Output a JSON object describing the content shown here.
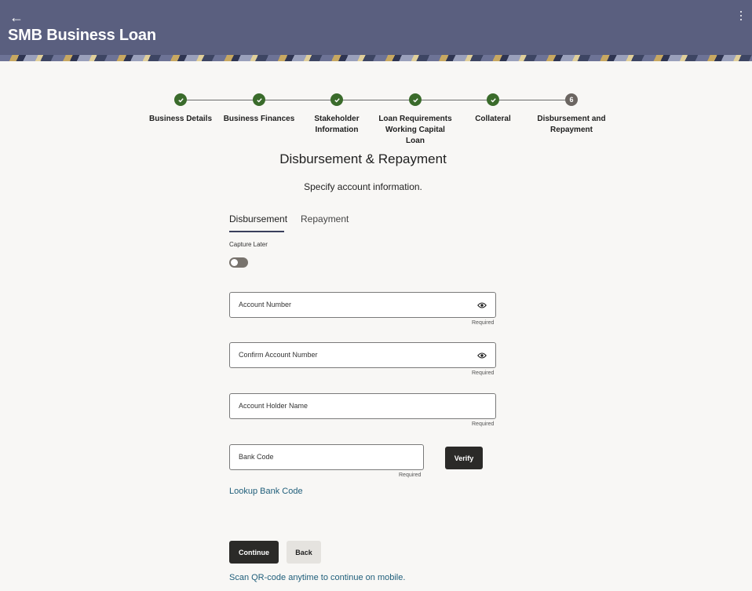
{
  "header": {
    "back_icon": "back-arrow-icon",
    "title": "SMB Business Loan",
    "menu_icon": "more-vertical-icon",
    "background_color": "#5a5f7f"
  },
  "stepper": {
    "steps": [
      {
        "label": "Business Details",
        "status": "done"
      },
      {
        "label": "Business Finances",
        "status": "done"
      },
      {
        "label": "Stakeholder Information",
        "status": "done"
      },
      {
        "label": "Loan Requirements Working Capital Loan",
        "status": "done"
      },
      {
        "label": "Collateral",
        "status": "done"
      },
      {
        "label": "Disbursement and Repayment",
        "status": "current",
        "number": "6"
      }
    ],
    "done_color": "#3a6b2b"
  },
  "main": {
    "title": "Disbursement & Repayment",
    "subtitle": "Specify account information.",
    "tabs": [
      {
        "label": "Disbursement",
        "active": true
      },
      {
        "label": "Repayment",
        "active": false
      }
    ],
    "capture_later_label": "Capture Later",
    "capture_later_on": false,
    "fields": {
      "account_number": {
        "label": "Account Number",
        "required": "Required",
        "icon": "eye-icon"
      },
      "confirm_account_number": {
        "label": "Confirm Account Number",
        "required": "Required",
        "icon": "eye-icon"
      },
      "account_holder_name": {
        "label": "Account Holder Name",
        "required": "Required"
      },
      "bank_code": {
        "label": "Bank Code",
        "required": "Required"
      }
    },
    "verify_label": "Verify",
    "lookup_link": "Lookup Bank Code",
    "continue_label": "Continue",
    "back_label": "Back",
    "qr_link": "Scan QR-code anytime to continue on mobile.",
    "link_color": "#1f5e7a"
  }
}
